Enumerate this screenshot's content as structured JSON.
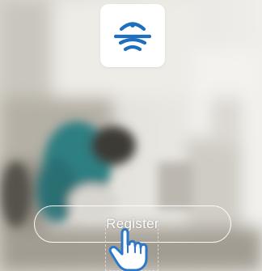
{
  "app": {
    "icon_name": "wifi-signal-icon",
    "icon_color": "#1f6fbf",
    "icon_background": "#ffffff"
  },
  "register": {
    "label": "Register"
  },
  "hint": {
    "icon_name": "tap-hand-icon",
    "icon_color": "#2b78c9"
  },
  "background": {
    "icon_name": "blurred-living-room-photo"
  }
}
